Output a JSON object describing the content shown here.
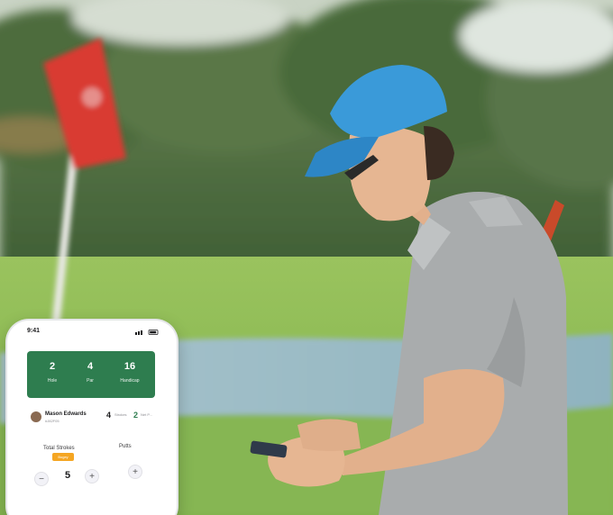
{
  "phone": {
    "status_time": "9:41",
    "stats": [
      {
        "value": "2",
        "label": "Hole"
      },
      {
        "value": "4",
        "label": "Par"
      },
      {
        "value": "16",
        "label": "Handicap"
      }
    ],
    "player": {
      "name": "Mason Edwards",
      "id": "#J82F05",
      "stat1_value": "4",
      "stat1_label": "Strokes",
      "stat2_value": "2",
      "stat2_label": "Net P..."
    },
    "total_strokes_label": "Total Strokes",
    "badge": "Bogey",
    "putts_label": "Putts",
    "strokes_value": "5",
    "minus": "−",
    "plus": "+"
  },
  "colors": {
    "card_green": "#2e7d4f",
    "badge_orange": "#f5a623",
    "flag_red": "#d93a33",
    "cap_blue": "#3a9ad9",
    "shirt_gray": "#a9acad"
  }
}
